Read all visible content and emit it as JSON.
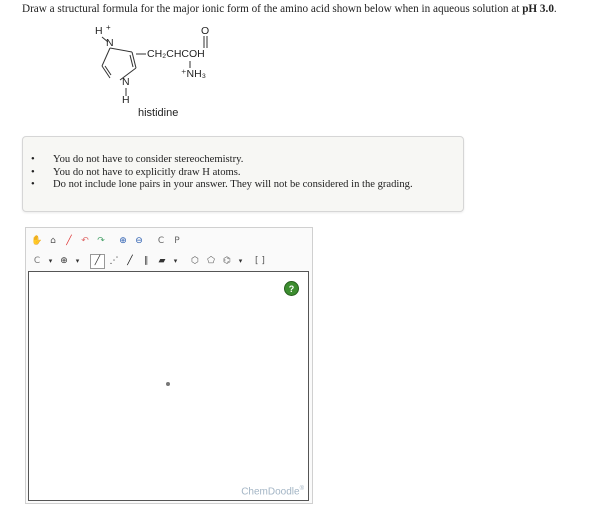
{
  "question": {
    "text_before": "Draw a structural formula for the major ionic form of the amino acid shown below when in aqueous solution at ",
    "bold": "pH 3.0",
    "text_after": "."
  },
  "structure": {
    "h_top": "H",
    "plus_top": "+",
    "n_top": "N",
    "n_bottom": "N",
    "h_bottom": "H",
    "side_chain": "CH₂CHCOH",
    "carbonyl_o": "O",
    "amine": "⁺NH₃",
    "caption": "histidine"
  },
  "notes": [
    "You do not have to consider stereochemistry.",
    "You do not have to explicitly draw H atoms.",
    "Do not include lone pairs in your answer. They will not be considered in the grading."
  ],
  "editor": {
    "help_label": "?",
    "brand": "ChemDoodle",
    "trademark": "®",
    "toolbar1": [
      {
        "name": "pan-hand-icon",
        "glyph": "✋",
        "color": "#c47a1c"
      },
      {
        "name": "lasso-icon",
        "glyph": "⌂",
        "color": "#555"
      },
      {
        "name": "eraser-icon",
        "glyph": "╱",
        "color": "#d33"
      },
      {
        "name": "undo-icon",
        "glyph": "↶",
        "color": "#e06b6b"
      },
      {
        "name": "redo-icon",
        "glyph": "↷",
        "color": "#4aa36b"
      },
      {
        "name": "zoom-in-icon",
        "glyph": "⊕",
        "color": "#2a5db0"
      },
      {
        "name": "zoom-out-icon",
        "glyph": "⊖",
        "color": "#2a5db0"
      },
      {
        "name": "copy-icon",
        "glyph": "C",
        "color": "#666"
      },
      {
        "name": "paste-icon",
        "glyph": "P",
        "color": "#666"
      }
    ],
    "toolbar2": [
      {
        "name": "carbon-atom-icon",
        "glyph": "C",
        "color": "#777"
      },
      {
        "name": "atom-dropdown-icon",
        "glyph": "▾",
        "color": "#333"
      },
      {
        "name": "charge-plus-icon",
        "glyph": "⊕",
        "color": "#333"
      },
      {
        "name": "charge-dropdown-icon",
        "glyph": "▾",
        "color": "#333"
      },
      {
        "name": "single-bond-icon",
        "glyph": "╱",
        "color": "#333",
        "selected": true
      },
      {
        "name": "wedge-bond-icon",
        "glyph": "⋰",
        "color": "#333"
      },
      {
        "name": "hash-bond-icon",
        "glyph": "╱",
        "color": "#111"
      },
      {
        "name": "double-bond-icon",
        "glyph": "∥",
        "color": "#333"
      },
      {
        "name": "bold-bond-icon",
        "glyph": "▰",
        "color": "#333"
      },
      {
        "name": "bond-dropdown-icon",
        "glyph": "▾",
        "color": "#333"
      },
      {
        "name": "cyclohexane-icon",
        "glyph": "⬡",
        "color": "#555"
      },
      {
        "name": "cyclopentane-icon",
        "glyph": "⬠",
        "color": "#555"
      },
      {
        "name": "benzene-icon",
        "glyph": "⌬",
        "color": "#555"
      },
      {
        "name": "ring-dropdown-icon",
        "glyph": "▾",
        "color": "#333"
      },
      {
        "name": "bracket-icon",
        "glyph": "[ ]",
        "color": "#555"
      }
    ]
  }
}
